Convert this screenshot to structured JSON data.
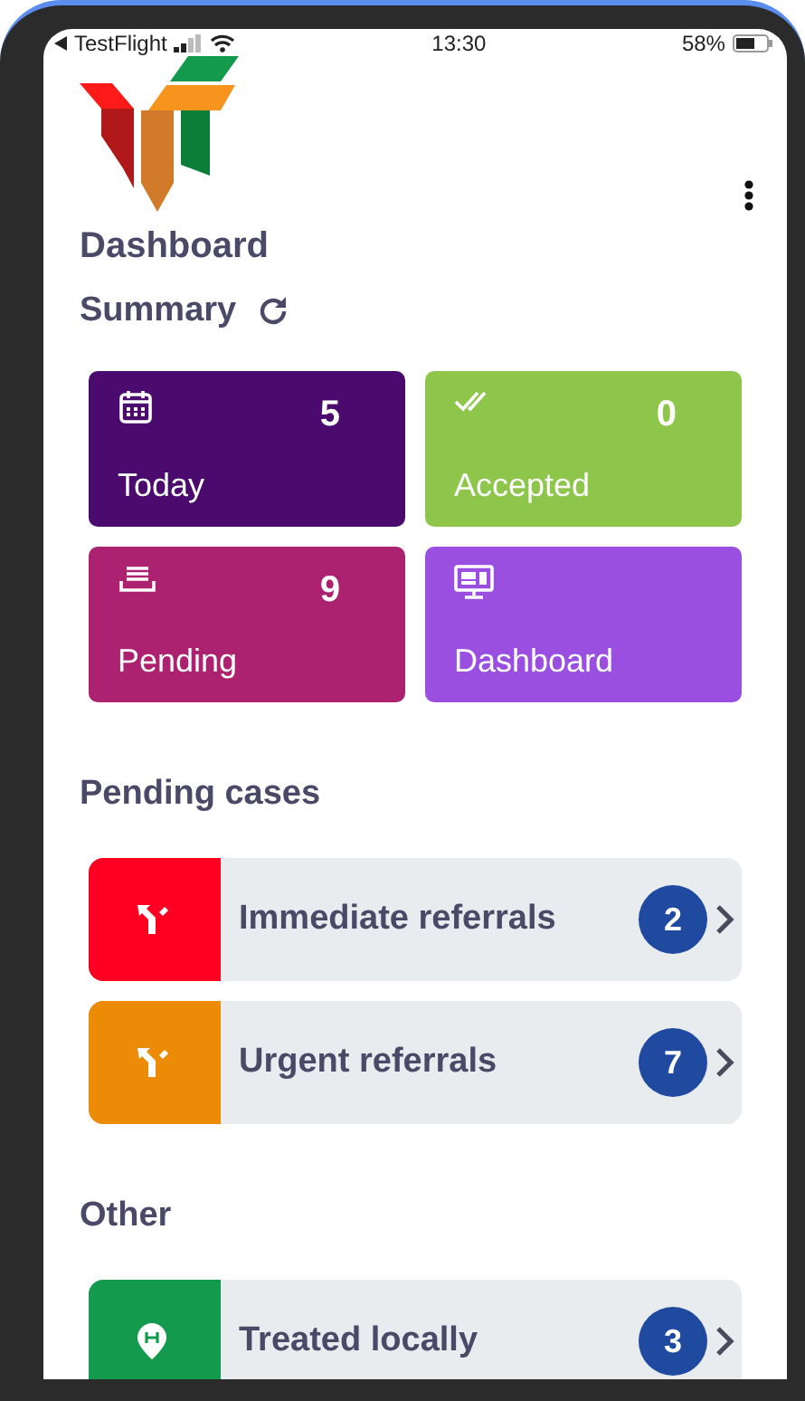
{
  "status_bar": {
    "back_label": "TestFlight",
    "time": "13:30",
    "battery": "58%"
  },
  "title": "Dashboard",
  "summary": {
    "title": "Summary"
  },
  "tiles": [
    {
      "kind": "calendar",
      "count": "5",
      "label": "Today",
      "color": "#4b0a6e"
    },
    {
      "kind": "double-check",
      "count": "0",
      "label": "Accepted",
      "color": "#8dc64b"
    },
    {
      "kind": "inbox",
      "count": "9",
      "label": "Pending",
      "color": "#ad2270"
    },
    {
      "kind": "monitor",
      "label": "Dashboard",
      "color": "#9a4fe0"
    }
  ],
  "sections": [
    {
      "title": "Pending cases",
      "items": [
        {
          "kind": "fork",
          "label": "Immediate referrals",
          "count": "2",
          "color": "#ff0022"
        },
        {
          "kind": "fork",
          "label": "Urgent referrals",
          "count": "7",
          "color": "#ec8b06"
        }
      ]
    },
    {
      "title": "Other",
      "items": [
        {
          "kind": "pin",
          "label": "Treated locally",
          "count": "3",
          "color": "#139a4c"
        }
      ]
    }
  ]
}
